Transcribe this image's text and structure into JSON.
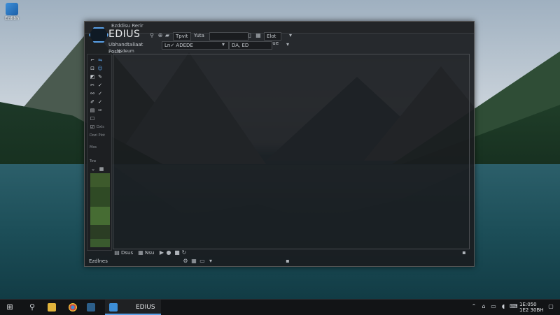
{
  "desktop": {
    "icon_label": "Ezdlbh"
  },
  "window": {
    "window_title": "Ezddisu Rerir",
    "app_title": "EDIUS",
    "toolbar_row1": {
      "label_a": "Tpvit",
      "label_b": "Yuta",
      "label_c": "Elot Poue"
    },
    "toolbar_row2": {
      "label_left": "Ubhandtaliaat Posis",
      "dropdown_a": "Ln✓ ADEDE",
      "dropdown_b": "DA, ED"
    },
    "row3_label": "Nsdeum",
    "tool_panel": {
      "label_1": "Dxls",
      "label_2": "Dozi Plot",
      "label_3": "Mos",
      "label_4": "Tow"
    },
    "bottom_bar": {
      "label_1": "Dsus",
      "label_2": "Nsu"
    },
    "status_left": "Ezdlnes"
  },
  "taskbar": {
    "app_label": "EDIUS",
    "clock_time": "1E:050",
    "clock_date": "1E2 30BH"
  }
}
